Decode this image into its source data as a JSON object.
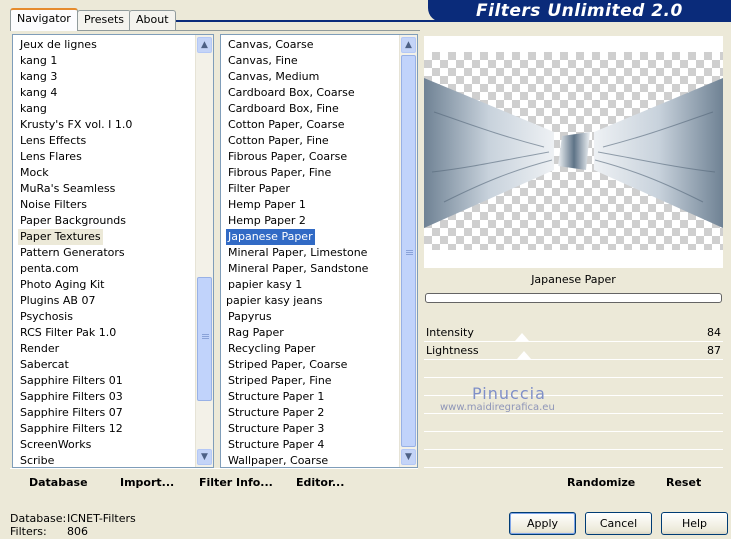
{
  "banner": {
    "title": "Filters Unlimited 2.0"
  },
  "tabs": [
    {
      "label": "Navigator"
    },
    {
      "label": "Presets"
    },
    {
      "label": "About"
    }
  ],
  "categories": {
    "items": [
      "Jeux de lignes",
      "kang 1",
      "kang 3",
      "kang 4",
      "kang",
      "Krusty's FX vol. I 1.0",
      "Lens Effects",
      "Lens Flares",
      "Mock",
      "MuRa's Seamless",
      "Noise Filters",
      "Paper Backgrounds",
      "Paper Textures",
      "Pattern Generators",
      "penta.com",
      "Photo Aging Kit",
      "Plugins AB 07",
      "Psychosis",
      "RCS Filter Pak 1.0",
      "Render",
      "Sabercat",
      "Sapphire Filters 01",
      "Sapphire Filters 03",
      "Sapphire Filters 07",
      "Sapphire Filters 12",
      "ScreenWorks",
      "Scribe"
    ],
    "selected": "Paper Textures"
  },
  "filters": {
    "items": [
      "Canvas, Coarse",
      "Canvas, Fine",
      "Canvas, Medium",
      "Cardboard Box, Coarse",
      "Cardboard Box, Fine",
      "Cotton Paper, Coarse",
      "Cotton Paper, Fine",
      "Fibrous Paper, Coarse",
      "Fibrous Paper, Fine",
      "Filter Paper",
      "Hemp Paper 1",
      "Hemp Paper 2",
      "Japanese Paper",
      "Mineral Paper, Limestone",
      "Mineral Paper, Sandstone",
      "papier kasy 1",
      "papier kasy jeans",
      "Papyrus",
      "Rag Paper",
      "Recycling Paper",
      "Striped Paper, Coarse",
      "Striped Paper, Fine",
      "Structure Paper 1",
      "Structure Paper 2",
      "Structure Paper 3",
      "Structure Paper 4",
      "Wallpaper, Coarse"
    ],
    "selected": "Japanese Paper",
    "checked": [
      "papier kasy jeans"
    ]
  },
  "preview": {
    "filter_name": "Japanese Paper",
    "watermark_name": "Pinuccia",
    "watermark_url": "www.maidiregrafica.eu"
  },
  "params": [
    {
      "label": "Intensity",
      "value": "84"
    },
    {
      "label": "Lightness",
      "value": "87"
    }
  ],
  "toolbar": {
    "database": "Database",
    "import": "Import...",
    "filter_info": "Filter Info...",
    "editor": "Editor...",
    "randomize": "Randomize",
    "reset": "Reset"
  },
  "status": {
    "database_label": "Database:",
    "database_value": "ICNET-Filters",
    "filters_label": "Filters:",
    "filters_value": "806"
  },
  "buttons": {
    "apply": "Apply",
    "cancel": "Cancel",
    "help": "Help"
  },
  "icons": {
    "scroll_up": "▲",
    "scroll_down": "▼"
  }
}
